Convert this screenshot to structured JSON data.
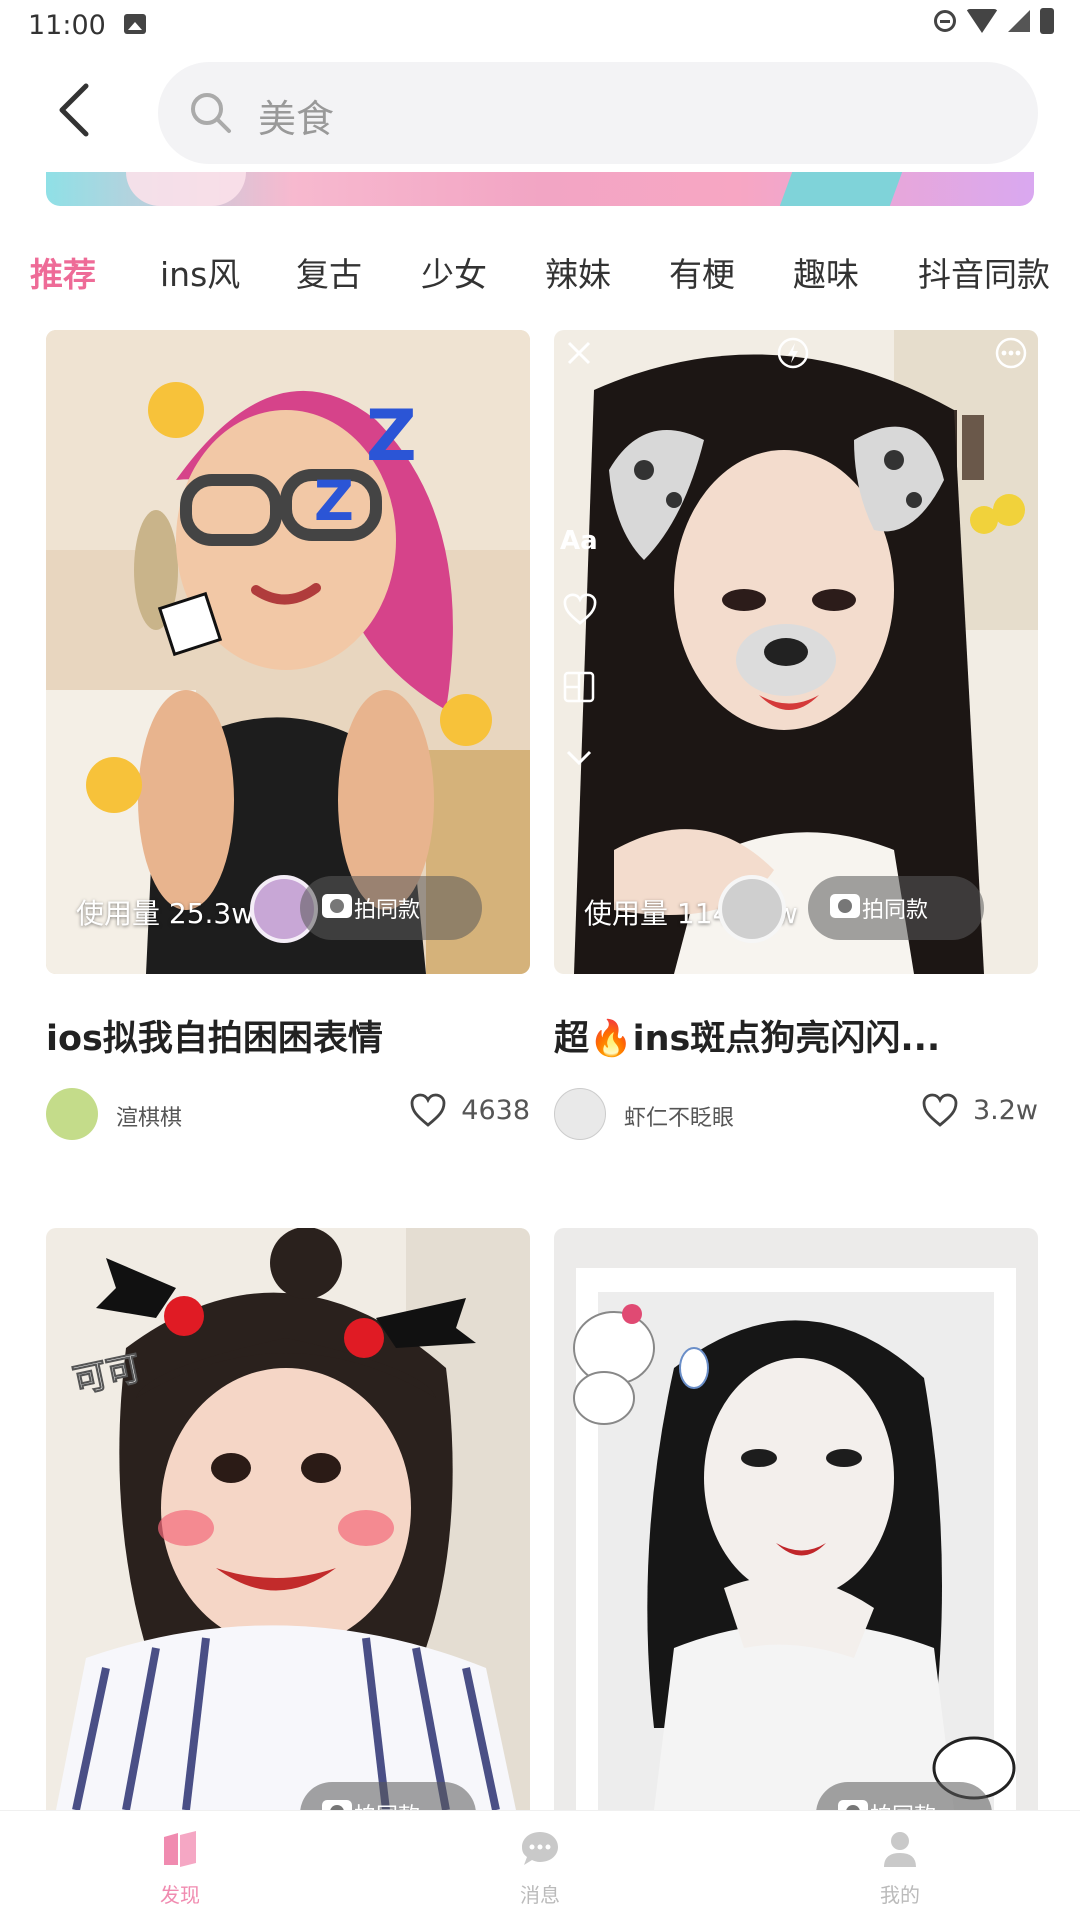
{
  "status_bar": {
    "time": "11:00"
  },
  "search": {
    "query": "美食"
  },
  "tabs": [
    {
      "label": "推荐",
      "active": true
    },
    {
      "label": "ins风"
    },
    {
      "label": "复古"
    },
    {
      "label": "少女"
    },
    {
      "label": "辣妹"
    },
    {
      "label": "有梗"
    },
    {
      "label": "趣味"
    },
    {
      "label": "抖音同款"
    }
  ],
  "cards": [
    {
      "usage": "使用量 25.3w",
      "shoot_label": "拍同款",
      "title": "ios拟我自拍困困表情",
      "author": "渲棋棋",
      "likes": "4638"
    },
    {
      "usage": "使用量 1144.7w",
      "shoot_label": "拍同款",
      "title": "超🔥ins斑点狗亮闪闪...",
      "author": "虾仁不眨眼",
      "likes": "3.2w",
      "overlay": {
        "text_tool": "Aa"
      }
    },
    {
      "shoot_label": "拍同款",
      "sticker_text": "可可"
    },
    {
      "shoot_label": "拍同款"
    }
  ],
  "bottom_nav": [
    {
      "label": "发现",
      "active": true
    },
    {
      "label": "消息"
    },
    {
      "label": "我的"
    }
  ],
  "colors": {
    "accent": "#ee6b97",
    "search_bg": "#f3f3f5"
  }
}
